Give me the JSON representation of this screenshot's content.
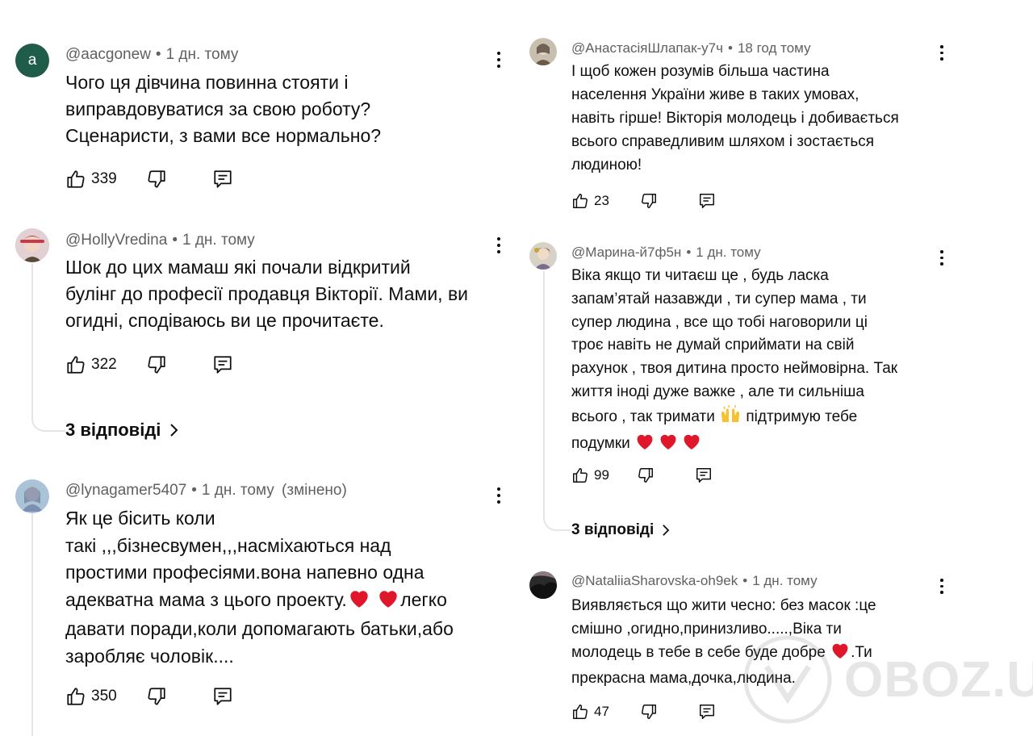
{
  "left": {
    "comments": [
      {
        "avatar_letter": "a",
        "avatar_color": "#1f5c4a",
        "handle": "@aacgonew",
        "time": "1 дн. тому",
        "edited": "",
        "text": "Чого ця дівчина повинна стояти і\nвиправдовуватися за свою роботу?\nСценаристи, з вами все нормально?",
        "likes": "339"
      },
      {
        "avatar_letter": "",
        "handle": "@HollyVredina",
        "time": "1 дн. тому",
        "edited": "",
        "text": "Шок до цих мамаш які почали відкритий\nбулінг до професії продавця Вікторії. Мами, ви\nогидні, сподіваюсь ви це прочитаєте.",
        "likes": "322",
        "replies": "3 відповіді"
      },
      {
        "avatar_letter": "",
        "handle": "@lynagamer5407",
        "time": "1 дн. тому",
        "edited": "(змінено)",
        "text_a": "Як це бісить коли\nтакі ,,,бізнесвумен,,,насміхаються над\nпростими професіями.вона напевно одна\nадекватна мама з цього проекту.",
        "text_b": "легко\nдавати поради,коли допомагають батьки,або\nзаробляє чоловік....",
        "likes": "350"
      }
    ]
  },
  "right": {
    "comments": [
      {
        "handle": "@АнастасіяШлапак-у7ч",
        "time": "18 год тому",
        "text": "І щоб кожен розумів більша частина\nнаселення України живе в таких умовах,\nнавіть гірше!  Вікторія молодець і добивається\nвсього справедливим шляхом і зостається\nлюдиною!",
        "likes": "23"
      },
      {
        "handle": "@Марина-й7ф5н",
        "time": "1 дн. тому",
        "text_a": "Віка якщо ти читаєш це , будь ласка\nзапам’ятай назавжди , ти супер мама , ти\nсупер людина , все що тобі наговорили ці\nтроє навіть не думай сприймати на свій\nрахунок , твоя дитина просто неймовірна. Так\nжиття іноді дуже важке , але ти сильніша\nвсього , так тримати ",
        "text_b": " підтримую тебе\nподумки ",
        "likes": "99",
        "replies": "3 відповіді"
      },
      {
        "handle": "@NataliiaSharovska-oh9ek",
        "time": "1 дн. тому",
        "text_a": "Виявляється що жити чесно: без масок :це\nсмішно ,огидно,принизливо.....,Віка  ти\nмолодець в тебе в себе буде добре ",
        "text_b": ".Ти\nпрекрасна мама,дочка,людина.",
        "likes": "47"
      }
    ]
  },
  "watermark": {
    "text": "OBOZ.UA"
  },
  "colors": {
    "heart": "#e0162b",
    "meta": "#606060",
    "thread": "#e5e5e5",
    "avatar_a": "#1f5c4a"
  }
}
